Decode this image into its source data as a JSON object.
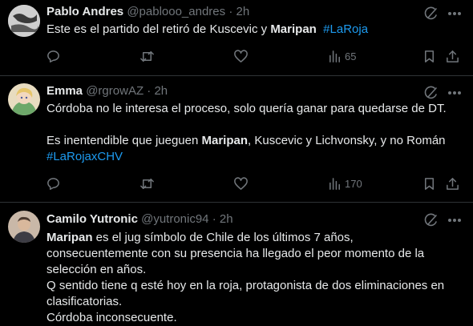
{
  "tweets": [
    {
      "name": "Pablo Andres",
      "handle": "@pablooo_andres",
      "time": "2h",
      "lines": [
        [
          {
            "t": "Este es el partido del retiró de Kuscevic y "
          },
          {
            "t": "Maripan",
            "b": true
          },
          {
            "t": "  "
          },
          {
            "t": "#LaRoja",
            "h": true
          }
        ]
      ],
      "views": "65"
    },
    {
      "name": "Emma",
      "handle": "@rgrowAZ",
      "time": "2h",
      "lines": [
        [
          {
            "t": "Córdoba no le interesa el proceso, solo quería ganar para quedarse de DT."
          }
        ],
        [],
        [
          {
            "t": "Es inentendible que jueguen "
          },
          {
            "t": "Maripan",
            "b": true
          },
          {
            "t": ", Kuscevic y Lichvonsky, y no Román"
          }
        ],
        [
          {
            "t": "#LaRojaxCHV",
            "h": true
          }
        ]
      ],
      "views": "170"
    },
    {
      "name": "Camilo Yutronic",
      "handle": "@yutronic94",
      "time": "2h",
      "lines": [
        [
          {
            "t": "Maripan",
            "b": true
          },
          {
            "t": " es el jug símbolo de Chile de los últimos 7 años,"
          }
        ],
        [
          {
            "t": "consecuentemente con su presencia ha llegado el peor momento de la"
          }
        ],
        [
          {
            "t": "selección en años."
          }
        ],
        [
          {
            "t": "Q sentido tiene q esté hoy en la roja, protagonista de dos eliminaciones en"
          }
        ],
        [
          {
            "t": "clasificatorias."
          }
        ],
        [
          {
            "t": "Córdoba inconsecuente."
          }
        ]
      ]
    }
  ],
  "separator": "·",
  "icons": [
    "grok-icon",
    "more-icon",
    "reply-icon",
    "retweet-icon",
    "like-icon",
    "views-icon",
    "bookmark-icon",
    "share-icon"
  ],
  "colors": {
    "background": "#000000",
    "text": "#e7e9ea",
    "muted": "#71767b",
    "hashtag": "#1d9bf0",
    "divider": "#2f3336"
  }
}
